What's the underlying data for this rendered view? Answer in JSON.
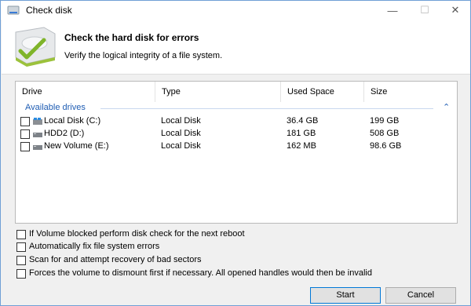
{
  "window": {
    "title": "Check disk"
  },
  "titlebar": {
    "minimize": "—",
    "maximize": "☐",
    "close": "✕"
  },
  "header": {
    "title": "Check the hard disk for errors",
    "subtitle": "Verify the logical integrity of a file system."
  },
  "table": {
    "columns": [
      "Drive",
      "Type",
      "Used Space",
      "Size"
    ],
    "group_label": "Available drives",
    "group_collapse": "⌃",
    "rows": [
      {
        "name": "Local Disk (C:)",
        "type": "Local Disk",
        "used": "36.4 GB",
        "size": "199 GB",
        "icon": "windows-drive-icon"
      },
      {
        "name": "HDD2 (D:)",
        "type": "Local Disk",
        "used": "181 GB",
        "size": "508 GB",
        "icon": "drive-icon"
      },
      {
        "name": "New Volume (E:)",
        "type": "Local Disk",
        "used": "162 MB",
        "size": "98.6 GB",
        "icon": "drive-icon"
      }
    ]
  },
  "options": [
    {
      "label": "If Volume blocked perform disk check for the next reboot",
      "checked": false
    },
    {
      "label": "Automatically fix file system errors",
      "checked": false
    },
    {
      "label": "Scan for and attempt recovery of bad sectors",
      "checked": false
    },
    {
      "label": "Forces the volume to dismount first if necessary. All opened handles would then be invalid",
      "checked": false
    }
  ],
  "buttons": {
    "start": "Start",
    "cancel": "Cancel"
  },
  "colors": {
    "accent": "#1e5cb3",
    "focus_border": "#0078d7"
  }
}
